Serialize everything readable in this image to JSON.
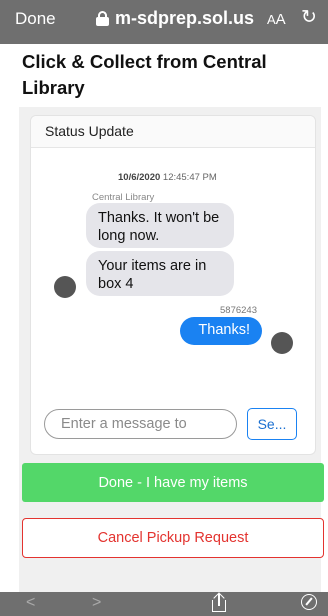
{
  "browser": {
    "done_label": "Done",
    "url": "m-sdprep.sol.us",
    "text_size_label_small": "A",
    "text_size_label_big": "A"
  },
  "page": {
    "title": "Click & Collect from Central Library"
  },
  "chat": {
    "header": "Status Update",
    "timestamp_date": "10/6/2020",
    "timestamp_time": "12:45:47 PM",
    "sender": "Central Library",
    "incoming": [
      "Thanks. It won't be long now.",
      "Your items are in box 4"
    ],
    "outgoing_id": "5876243",
    "outgoing": "Thanks!",
    "input_placeholder": "Enter a message to",
    "send_label": "Se..."
  },
  "actions": {
    "done_label": "Done - I have my items",
    "cancel_label": "Cancel Pickup Request"
  },
  "icons": {
    "lock": "lock-icon",
    "reload": "reload-icon",
    "back": "chevron-left-icon",
    "forward": "chevron-right-icon",
    "share": "share-icon",
    "compass": "compass-icon"
  },
  "colors": {
    "accent_blue": "#1a82f2",
    "done_green": "#53d769",
    "cancel_red": "#e3332f",
    "browser_bar": "#6f6f6f"
  }
}
